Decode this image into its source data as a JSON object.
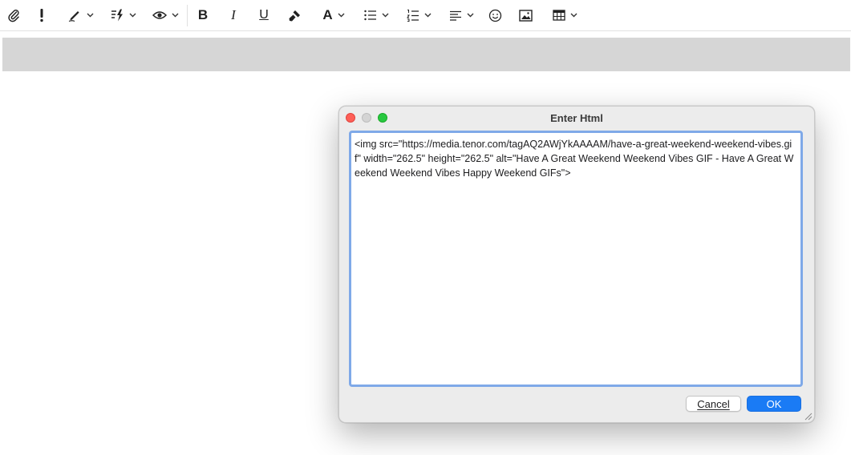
{
  "toolbar": {
    "items": [
      {
        "name": "attach",
        "icon": "paperclip-icon"
      },
      {
        "name": "priority",
        "icon": "exclamation-icon"
      },
      {
        "name": "signature",
        "icon": "pen-icon"
      },
      {
        "name": "actions",
        "icon": "lightning-icon"
      },
      {
        "name": "view",
        "icon": "eye-icon"
      },
      {
        "name": "bold",
        "icon": "bold-icon"
      },
      {
        "name": "italic",
        "icon": "italic-icon"
      },
      {
        "name": "underline",
        "icon": "underline-icon"
      },
      {
        "name": "format-painter",
        "icon": "paintbrush-icon"
      },
      {
        "name": "font",
        "icon": "font-icon"
      },
      {
        "name": "bullets",
        "icon": "bullet-list-icon"
      },
      {
        "name": "numbering",
        "icon": "numbered-list-icon"
      },
      {
        "name": "align",
        "icon": "align-left-icon"
      },
      {
        "name": "emoji",
        "icon": "smiley-icon"
      },
      {
        "name": "picture",
        "icon": "image-icon"
      },
      {
        "name": "table",
        "icon": "table-icon"
      }
    ],
    "labels": {
      "bold": "B",
      "italic": "I",
      "underline": "U",
      "font": "A"
    }
  },
  "dialog": {
    "title": "Enter Html",
    "content": "<img src=\"https://media.tenor.com/tagAQ2AWjYkAAAAM/have-a-great-weekend-weekend-vibes.gif\" width=\"262.5\" height=\"262.5\" alt=\"Have A Great Weekend Weekend Vibes GIF - Have A Great Weekend Weekend Vibes Happy Weekend GIFs\">",
    "cancel_label": "Cancel",
    "ok_label": "OK"
  },
  "colors": {
    "accent": "#1a7bf5",
    "focus_ring": "#7fa9e8",
    "close_light": "#fe5f57",
    "zoom_light": "#28c840"
  }
}
